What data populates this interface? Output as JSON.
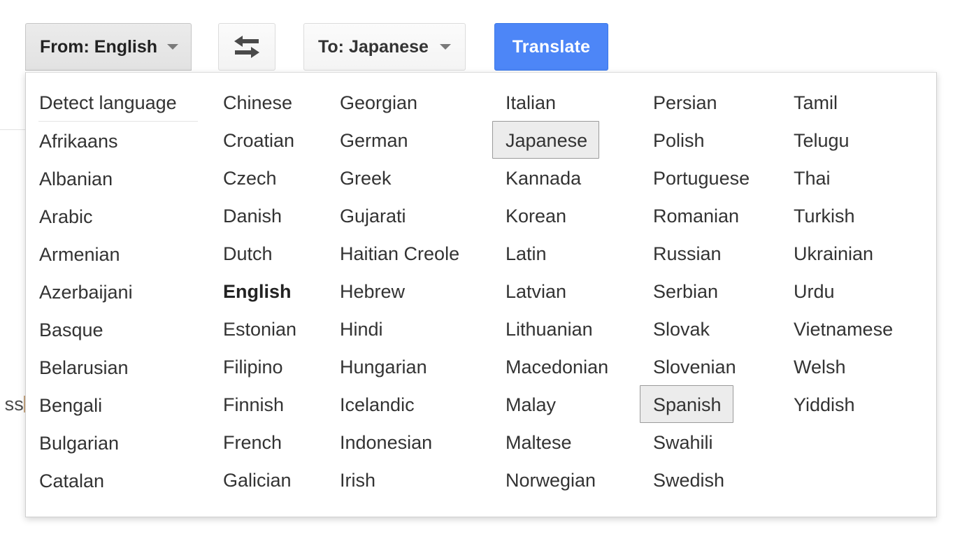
{
  "toolbar": {
    "from_button": {
      "label": "From: English",
      "caret": "chevron-down-icon",
      "state": "pressed"
    },
    "swap_button": {
      "icon": "swap-arrows-icon",
      "title": "Swap languages"
    },
    "to_button": {
      "label": "To: Japanese",
      "caret": "chevron-down-icon"
    },
    "translate_button": {
      "label": "Translate",
      "color": "#4d86f7"
    }
  },
  "background": {
    "text_fragment": "ss"
  },
  "dropdown": {
    "columns": [
      {
        "items": [
          {
            "label": "Detect language",
            "separator_after": true
          },
          {
            "label": "Afrikaans"
          },
          {
            "label": "Albanian"
          },
          {
            "label": "Arabic"
          },
          {
            "label": "Armenian"
          },
          {
            "label": "Azerbaijani"
          },
          {
            "label": "Basque"
          },
          {
            "label": "Belarusian"
          },
          {
            "label": "Bengali"
          },
          {
            "label": "Bulgarian"
          },
          {
            "label": "Catalan"
          }
        ]
      },
      {
        "items": [
          {
            "label": "Chinese"
          },
          {
            "label": "Croatian"
          },
          {
            "label": "Czech"
          },
          {
            "label": "Danish"
          },
          {
            "label": "Dutch"
          },
          {
            "label": "English",
            "bold": true
          },
          {
            "label": "Estonian"
          },
          {
            "label": "Filipino"
          },
          {
            "label": "Finnish"
          },
          {
            "label": "French"
          },
          {
            "label": "Galician"
          }
        ]
      },
      {
        "items": [
          {
            "label": "Georgian"
          },
          {
            "label": "German"
          },
          {
            "label": "Greek"
          },
          {
            "label": "Gujarati"
          },
          {
            "label": "Haitian Creole"
          },
          {
            "label": "Hebrew"
          },
          {
            "label": "Hindi"
          },
          {
            "label": "Hungarian"
          },
          {
            "label": "Icelandic"
          },
          {
            "label": "Indonesian"
          },
          {
            "label": "Irish"
          }
        ]
      },
      {
        "items": [
          {
            "label": "Italian"
          },
          {
            "label": "Japanese",
            "highlighted": true
          },
          {
            "label": "Kannada"
          },
          {
            "label": "Korean"
          },
          {
            "label": "Latin"
          },
          {
            "label": "Latvian"
          },
          {
            "label": "Lithuanian"
          },
          {
            "label": "Macedonian"
          },
          {
            "label": "Malay"
          },
          {
            "label": "Maltese"
          },
          {
            "label": "Norwegian"
          }
        ]
      },
      {
        "items": [
          {
            "label": "Persian"
          },
          {
            "label": "Polish"
          },
          {
            "label": "Portuguese"
          },
          {
            "label": "Romanian"
          },
          {
            "label": "Russian"
          },
          {
            "label": "Serbian"
          },
          {
            "label": "Slovak"
          },
          {
            "label": "Slovenian"
          },
          {
            "label": "Spanish",
            "highlighted": true
          },
          {
            "label": "Swahili"
          },
          {
            "label": "Swedish"
          }
        ]
      },
      {
        "items": [
          {
            "label": "Tamil"
          },
          {
            "label": "Telugu"
          },
          {
            "label": "Thai"
          },
          {
            "label": "Turkish"
          },
          {
            "label": "Ukrainian"
          },
          {
            "label": "Urdu"
          },
          {
            "label": "Vietnamese"
          },
          {
            "label": "Welsh"
          },
          {
            "label": "Yiddish"
          }
        ]
      }
    ]
  }
}
